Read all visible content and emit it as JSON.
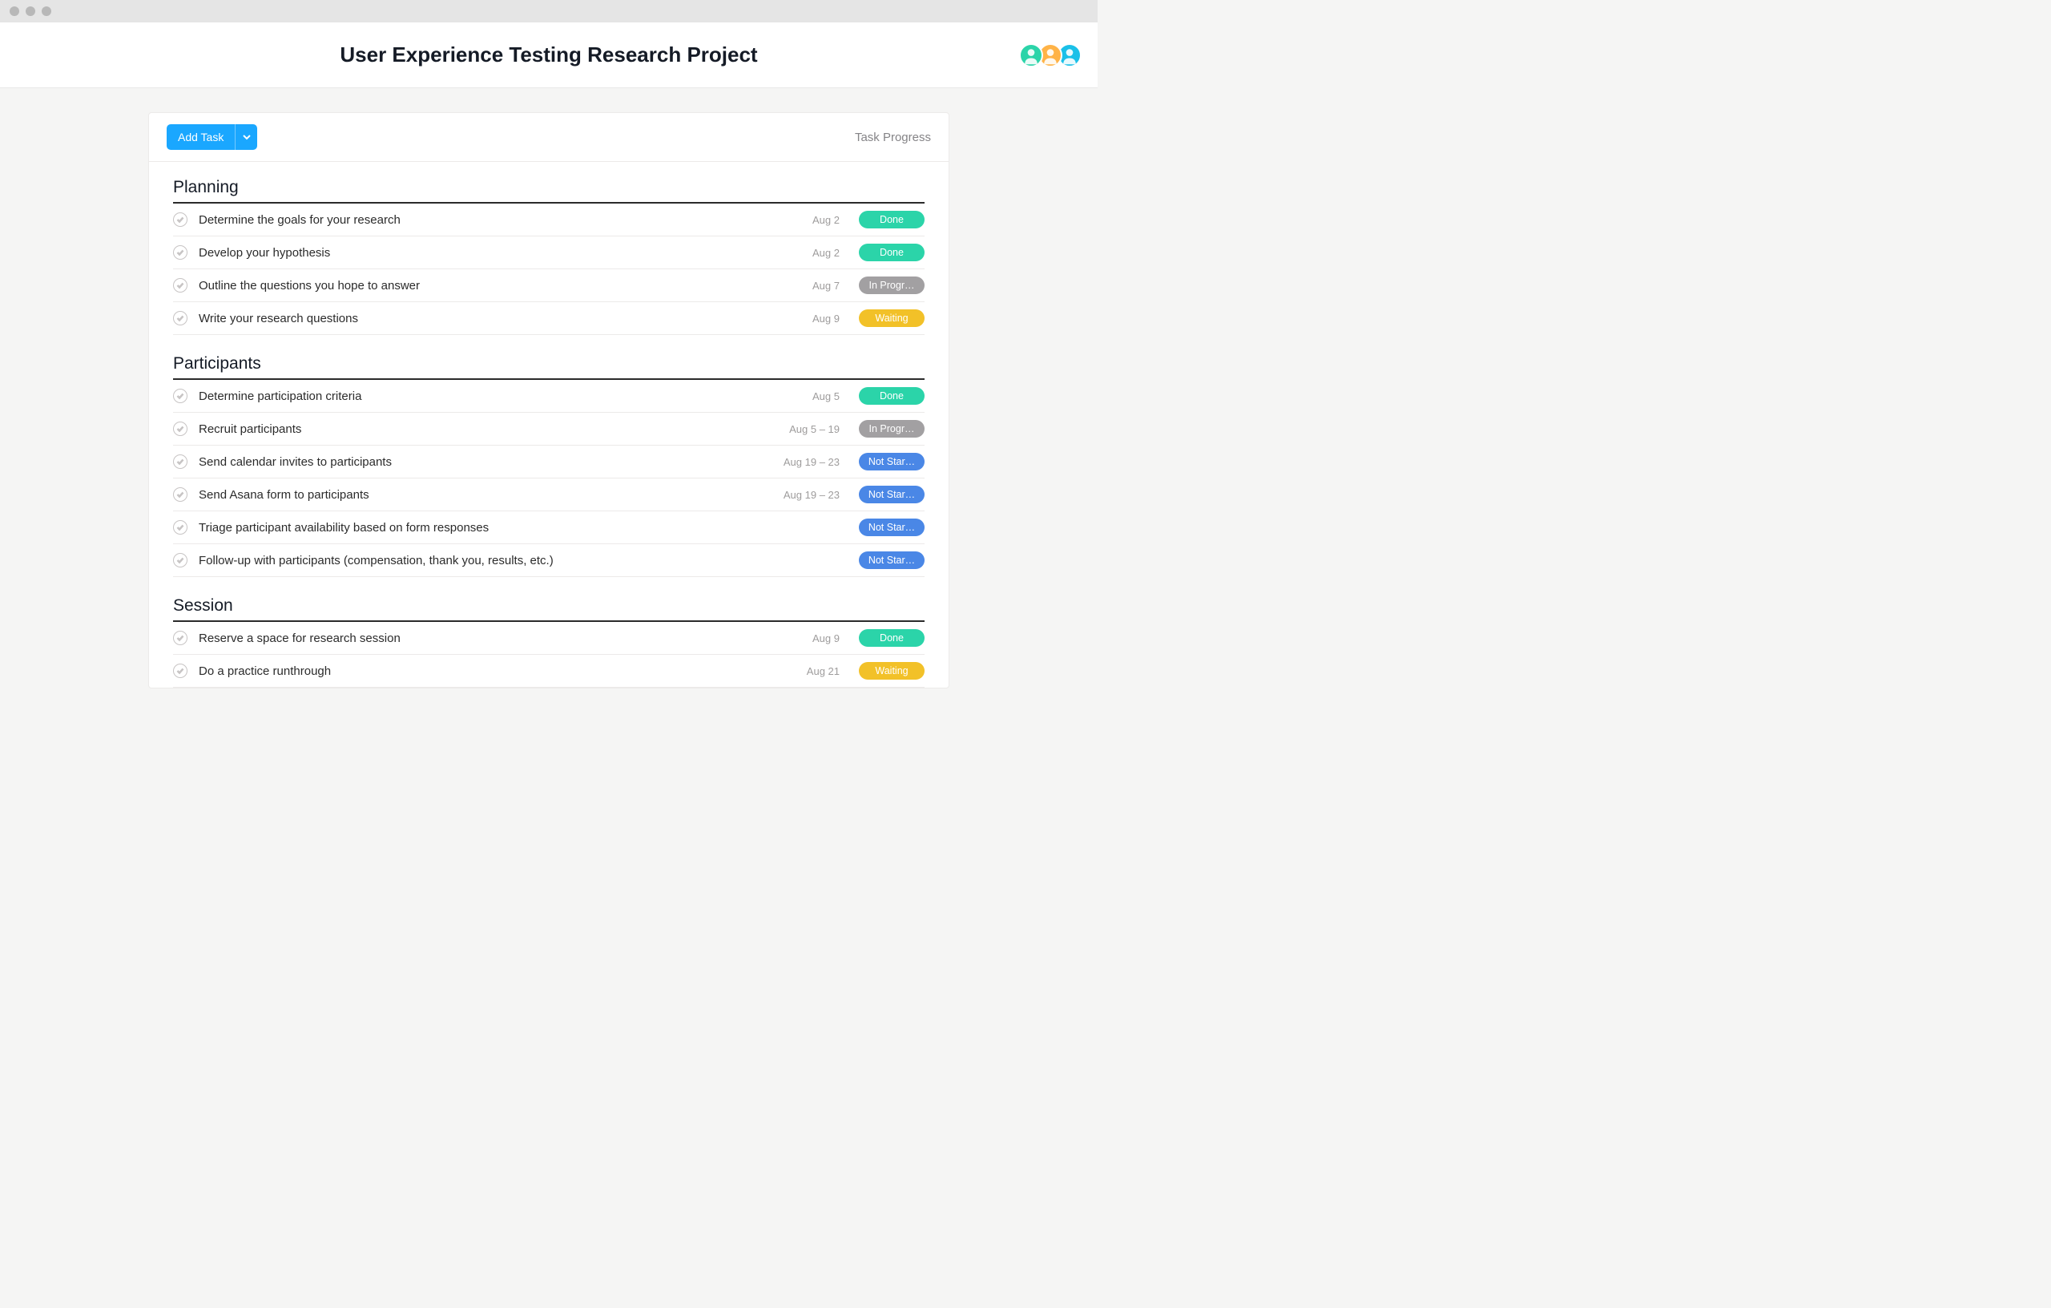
{
  "header": {
    "title": "User Experience Testing Research Project"
  },
  "toolbar": {
    "add_task_label": "Add Task",
    "right_label": "Task Progress"
  },
  "avatars": [
    {
      "bg": "#2bd4a9"
    },
    {
      "bg": "#ffb347"
    },
    {
      "bg": "#1ac0e8"
    }
  ],
  "status_colors": {
    "Done": "#2bd4a9",
    "In Progr…": "#a2a0a2",
    "Waiting": "#f2c128",
    "Not Star…": "#4a87e6"
  },
  "sections": [
    {
      "name": "Planning",
      "tasks": [
        {
          "title": "Determine the goals for your research",
          "date": "Aug 2",
          "status": "Done"
        },
        {
          "title": "Develop your hypothesis",
          "date": "Aug 2",
          "status": "Done"
        },
        {
          "title": "Outline the questions you hope to answer",
          "date": "Aug 7",
          "status": "In Progr…"
        },
        {
          "title": "Write your research questions",
          "date": "Aug 9",
          "status": "Waiting"
        }
      ]
    },
    {
      "name": "Participants",
      "tasks": [
        {
          "title": "Determine participation criteria",
          "date": "Aug 5",
          "status": "Done"
        },
        {
          "title": "Recruit participants",
          "date": "Aug 5 – 19",
          "status": "In Progr…"
        },
        {
          "title": "Send calendar invites to participants",
          "date": "Aug 19 – 23",
          "status": "Not Star…"
        },
        {
          "title": "Send Asana form to participants",
          "date": "Aug 19 – 23",
          "status": "Not Star…"
        },
        {
          "title": "Triage participant availability based on form responses",
          "date": "",
          "status": "Not Star…"
        },
        {
          "title": "Follow-up with participants (compensation, thank you, results, etc.)",
          "date": "",
          "status": "Not Star…"
        }
      ]
    },
    {
      "name": "Session",
      "tasks": [
        {
          "title": "Reserve a space for research session",
          "date": "Aug 9",
          "status": "Done"
        },
        {
          "title": "Do a practice runthrough",
          "date": "Aug 21",
          "status": "Waiting"
        }
      ]
    }
  ]
}
